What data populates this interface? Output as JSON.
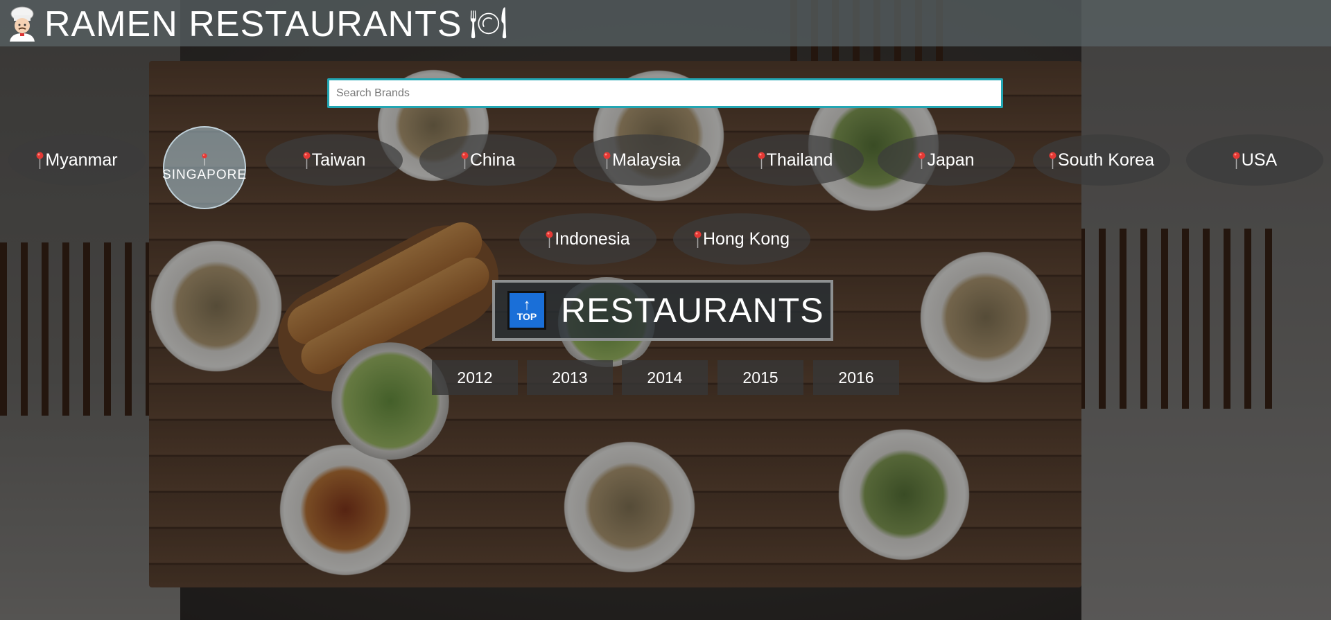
{
  "header": {
    "title": "RAMEN RESTAURANTS",
    "logo_icon": "chef-icon",
    "dish_icon": "plate-cutlery-icon"
  },
  "search": {
    "placeholder": "Search Brands",
    "value": "",
    "border_color": "#22a6b3"
  },
  "countries": [
    {
      "label": "Myanmar",
      "active": false
    },
    {
      "label": "SINGAPORE",
      "active": true
    },
    {
      "label": "Taiwan",
      "active": false
    },
    {
      "label": "China",
      "active": false
    },
    {
      "label": "Malaysia",
      "active": false
    },
    {
      "label": "Thailand",
      "active": false
    },
    {
      "label": "Japan",
      "active": false
    },
    {
      "label": "South Korea",
      "active": false
    },
    {
      "label": "USA",
      "active": false
    },
    {
      "label": "Indonesia",
      "active": false
    },
    {
      "label": "Hong Kong",
      "active": false
    }
  ],
  "pin_icon": "map-pin-icon",
  "pin_color": "#e53935",
  "section": {
    "title": "RESTAURANTS",
    "top_button_label": "TOP",
    "top_button_color": "#1a6fd8"
  },
  "years": [
    "2012",
    "2013",
    "2014",
    "2015",
    "2016"
  ]
}
